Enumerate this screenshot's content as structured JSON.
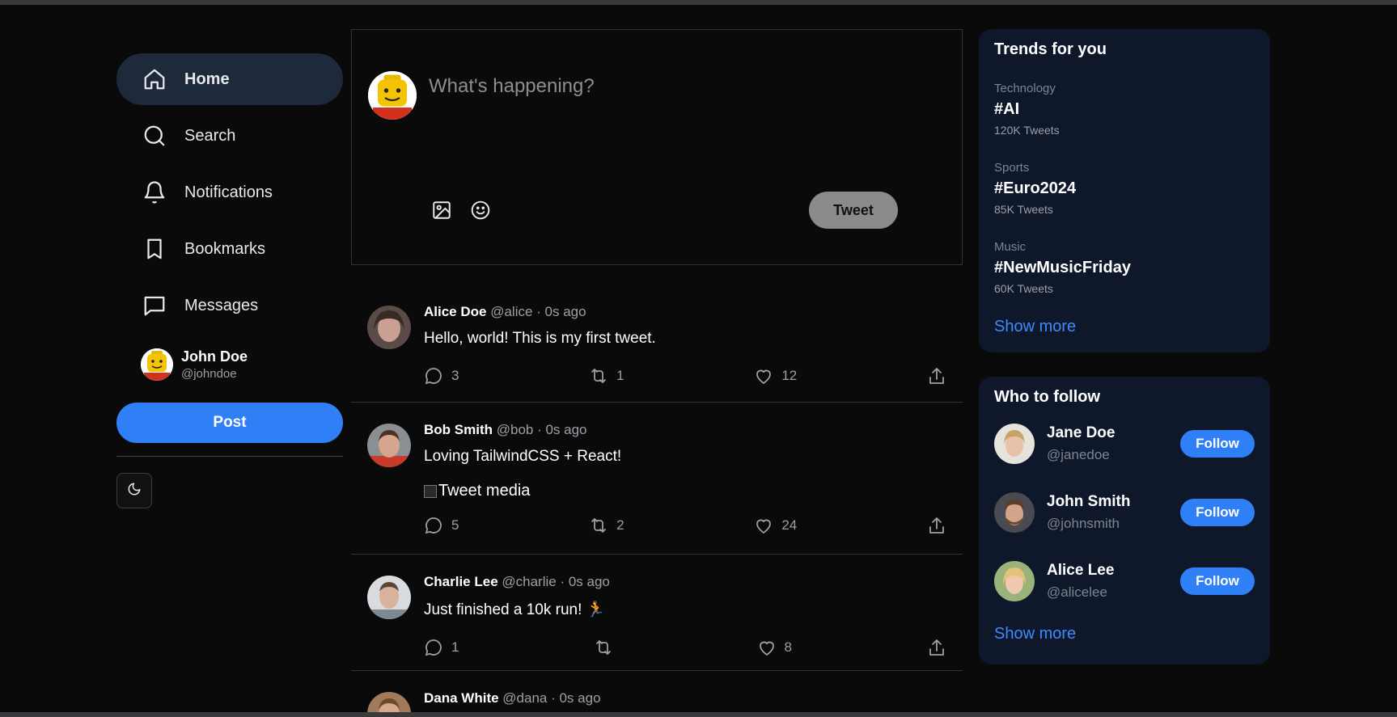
{
  "nav": {
    "items": [
      {
        "label": "Home",
        "icon": "home-icon"
      },
      {
        "label": "Search",
        "icon": "search-icon"
      },
      {
        "label": "Notifications",
        "icon": "bell-icon"
      },
      {
        "label": "Bookmarks",
        "icon": "bookmark-icon"
      },
      {
        "label": "Messages",
        "icon": "message-icon"
      }
    ],
    "active": "Home"
  },
  "profile": {
    "name": "John Doe",
    "handle": "@johndoe"
  },
  "post_label": "Post",
  "theme_toggle_icon": "moon-icon",
  "composer": {
    "placeholder": "What's happening?",
    "tweet_label": "Tweet",
    "tools": [
      "image-icon",
      "emoji-icon"
    ]
  },
  "tweets": [
    {
      "name": "Alice Doe",
      "meta": "@alice · 0s ago",
      "text": "Hello, world! This is my first tweet.",
      "replies": "3",
      "retweets": "1",
      "likes": "12"
    },
    {
      "name": "Bob Smith",
      "meta": "@bob · 0s ago",
      "text": "Loving TailwindCSS + React!",
      "media_alt": "Tweet media",
      "replies": "5",
      "retweets": "2",
      "likes": "24"
    },
    {
      "name": "Charlie Lee",
      "meta": "@charlie · 0s ago",
      "text": "Just finished a 10k run! 🏃",
      "replies": "1",
      "retweets": "",
      "likes": "8"
    },
    {
      "name": "Dana White",
      "meta": "@dana · 0s ago"
    }
  ],
  "trends": {
    "title": "Trends for you",
    "items": [
      {
        "category": "Technology",
        "tag": "#AI",
        "count": "120K Tweets"
      },
      {
        "category": "Sports",
        "tag": "#Euro2024",
        "count": "85K Tweets"
      },
      {
        "category": "Music",
        "tag": "#NewMusicFriday",
        "count": "60K Tweets"
      }
    ],
    "show_more": "Show more"
  },
  "who_to_follow": {
    "title": "Who to follow",
    "items": [
      {
        "name": "Jane Doe",
        "handle": "@janedoe",
        "button": "Follow"
      },
      {
        "name": "John Smith",
        "handle": "@johnsmith",
        "button": "Follow"
      },
      {
        "name": "Alice Lee",
        "handle": "@alicelee",
        "button": "Follow"
      }
    ],
    "show_more": "Show more"
  },
  "colors": {
    "accent": "#2f80f7",
    "card_bg": "#0f172a",
    "active_nav": "#1e293b"
  }
}
